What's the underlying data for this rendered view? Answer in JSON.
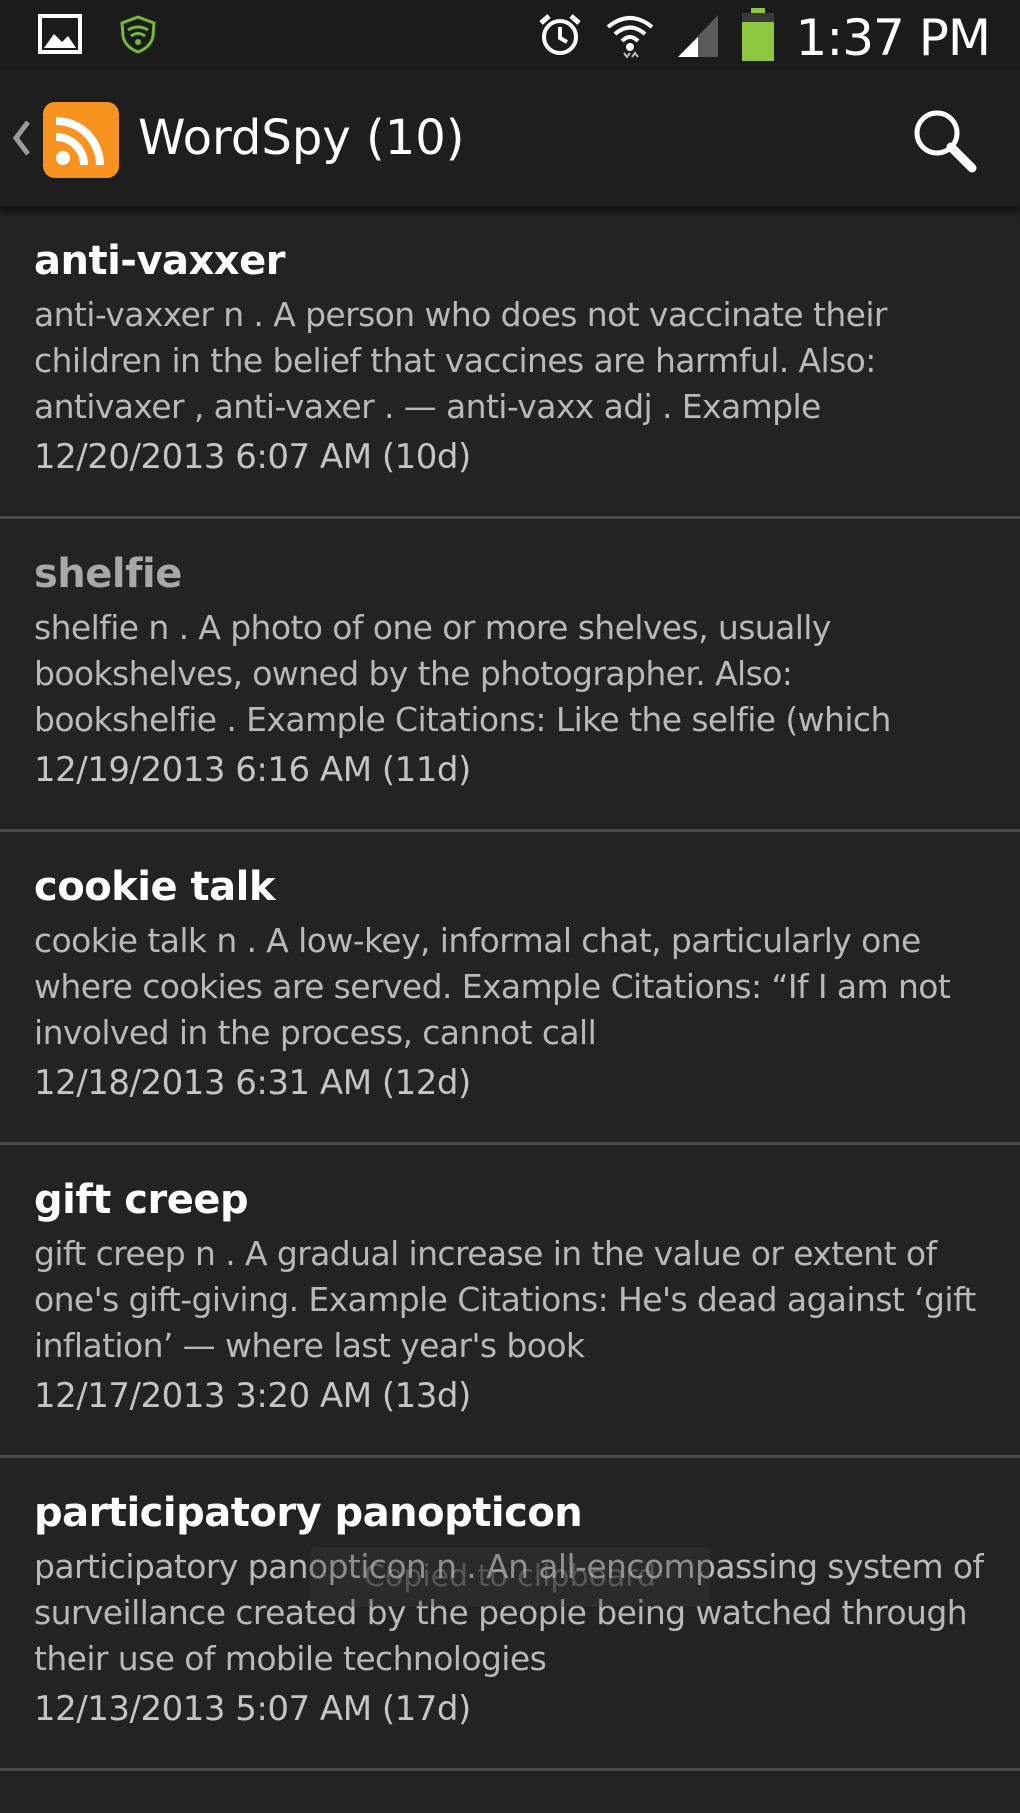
{
  "status_bar": {
    "time": "1:37 PM",
    "icons": [
      "gallery-icon",
      "shield-icon",
      "alarm-icon",
      "wifi-icon",
      "signal-icon",
      "battery-icon"
    ],
    "battery_color": "#8dc63f",
    "shield_color": "#76b83a"
  },
  "action_bar": {
    "title": "WordSpy (10)",
    "icon": "rss-icon",
    "icon_color": "#f7931e"
  },
  "items": [
    {
      "title": "anti-vaxxer",
      "body": "anti-vaxxer n . A person who does not vaccinate their children in the belief that vaccines are harmful. Also: antivaxer , anti-vaxer . — anti-vaxx adj . Example",
      "date": "12/20/2013 6:07 AM (10d)",
      "read": false
    },
    {
      "title": "shelfie",
      "body": "shelfie n . A photo of one or more shelves, usually bookshelves, owned by the photographer. Also: bookshelfie . Example Citations: Like the selfie (which",
      "date": "12/19/2013 6:16 AM (11d)",
      "read": true
    },
    {
      "title": "cookie talk",
      "body": "cookie talk n . A low-key, informal chat, particularly one where cookies are served. Example Citations: “If I am not involved in the process, cannot call",
      "date": "12/18/2013 6:31 AM (12d)",
      "read": false
    },
    {
      "title": "gift creep",
      "body": "gift creep n . A gradual increase in the value or extent of one's gift-giving. Example Citations: He's dead against ‘gift inflation’ — where last year's book",
      "date": "12/17/2013 3:20 AM (13d)",
      "read": false
    },
    {
      "title": "participatory panopticon",
      "body": "participatory panopticon n . An all-encompassing system of surveillance created by the people being watched through their use of mobile technologies",
      "date": "12/13/2013 5:07 AM (17d)",
      "read": false
    }
  ],
  "toast": "Copied to clipboard"
}
